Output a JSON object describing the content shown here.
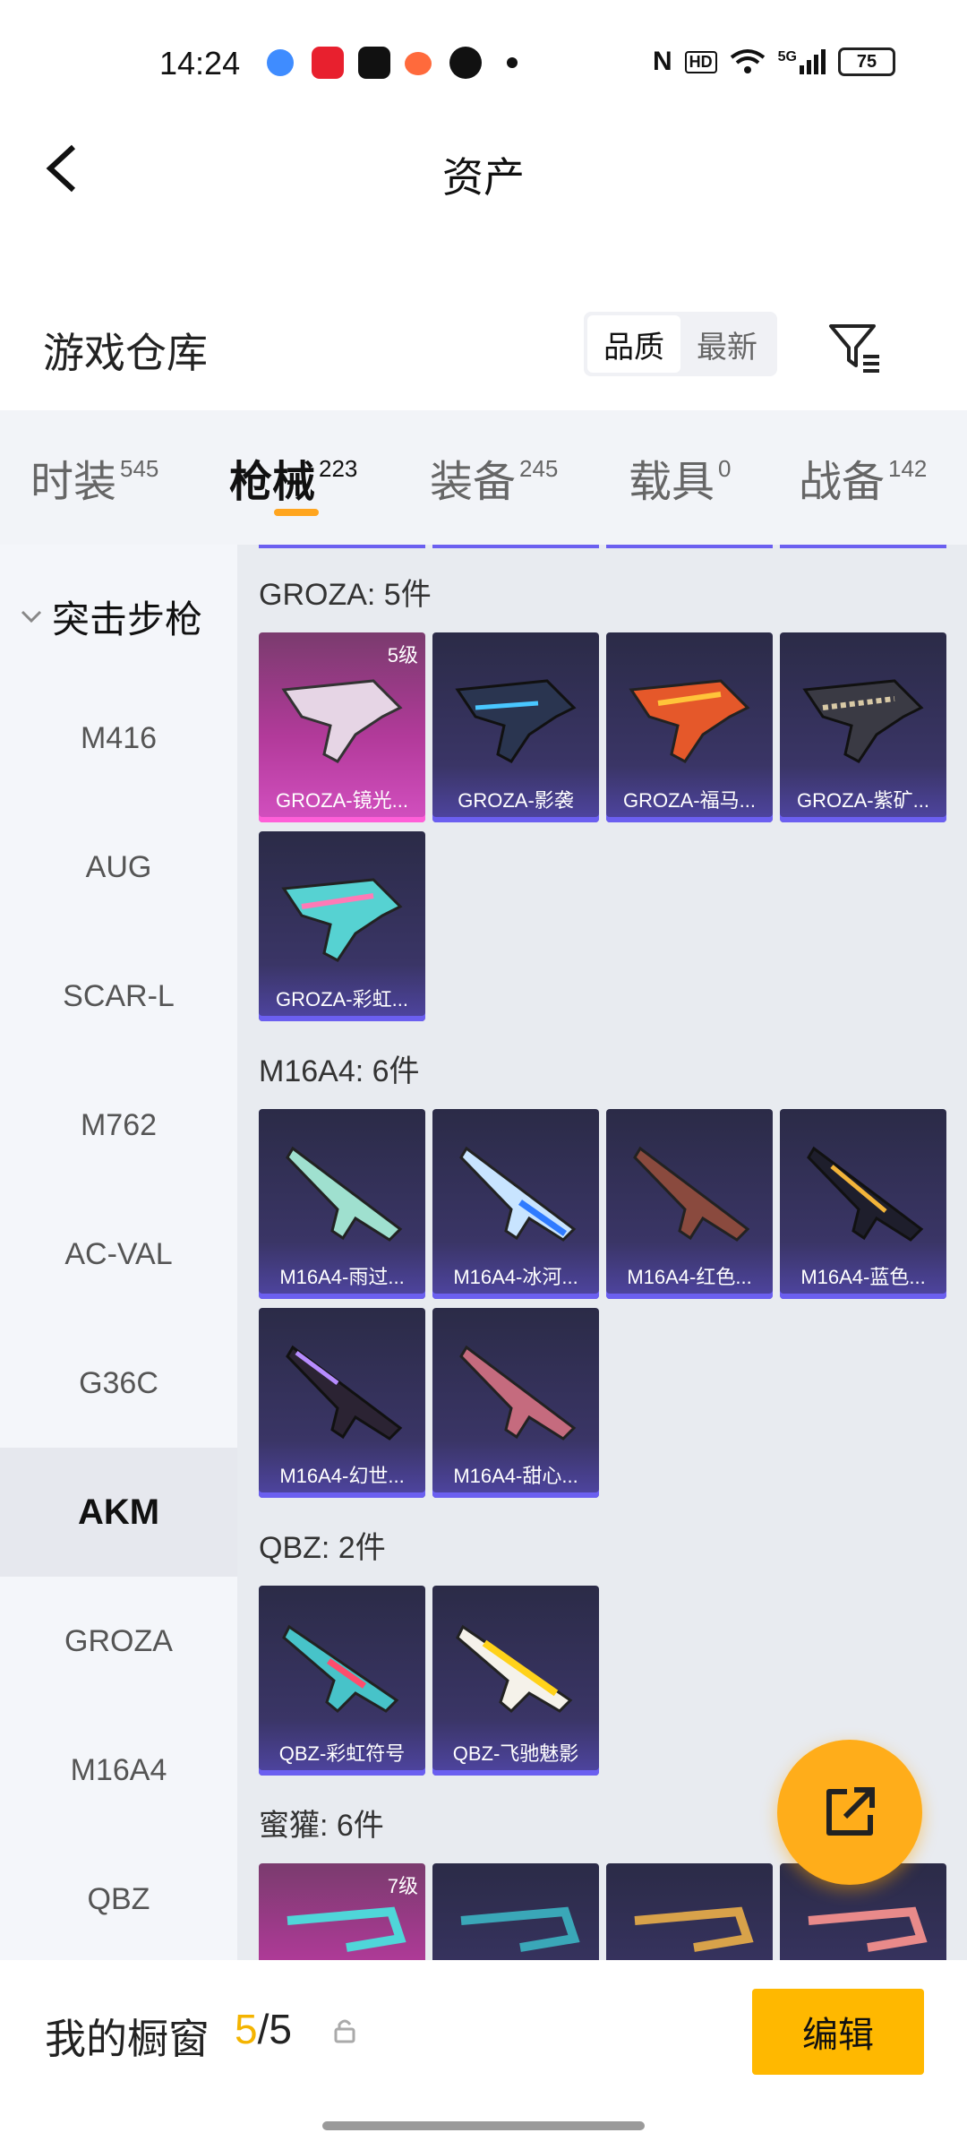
{
  "status_bar": {
    "time": "14:24",
    "network": "5G",
    "hd": "HD",
    "battery": "75"
  },
  "header": {
    "title": "资产",
    "back_icon": "back-arrow-icon"
  },
  "section": {
    "title": "游戏仓库",
    "sort_options": [
      "品质",
      "最新"
    ],
    "active_sort": "品质",
    "filter_icon": "filter-icon"
  },
  "tabs": [
    {
      "label": "时装",
      "count": "545"
    },
    {
      "label": "枪械",
      "count": "223",
      "active": true
    },
    {
      "label": "装备",
      "count": "245"
    },
    {
      "label": "载具",
      "count": "0"
    },
    {
      "label": "战备",
      "count": "142"
    }
  ],
  "sidebar": {
    "category": "突击步枪",
    "items": [
      "M416",
      "AUG",
      "SCAR-L",
      "M762",
      "AC-VAL",
      "G36C",
      "AKM",
      "GROZA",
      "M16A4",
      "QBZ"
    ],
    "active_item": "AKM"
  },
  "groups": [
    {
      "title": "GROZA: 5件",
      "items": [
        {
          "label": "GROZA-镜光...",
          "level": "5级",
          "rarity": "legend"
        },
        {
          "label": "GROZA-影袭",
          "rarity": "epic"
        },
        {
          "label": "GROZA-福马...",
          "rarity": "epic"
        },
        {
          "label": "GROZA-紫矿...",
          "rarity": "epic"
        },
        {
          "label": "GROZA-彩虹...",
          "rarity": "epic"
        }
      ]
    },
    {
      "title": "M16A4: 6件",
      "items": [
        {
          "label": "M16A4-雨过...",
          "rarity": "epic"
        },
        {
          "label": "M16A4-冰河...",
          "rarity": "epic"
        },
        {
          "label": "M16A4-红色...",
          "rarity": "epic"
        },
        {
          "label": "M16A4-蓝色...",
          "rarity": "epic"
        },
        {
          "label": "M16A4-幻世...",
          "rarity": "epic"
        },
        {
          "label": "M16A4-甜心...",
          "rarity": "epic"
        }
      ]
    },
    {
      "title": "QBZ: 2件",
      "items": [
        {
          "label": "QBZ-彩虹符号",
          "rarity": "epic"
        },
        {
          "label": "QBZ-飞驰魅影",
          "rarity": "epic"
        }
      ]
    },
    {
      "title": "蜜獾: 6件",
      "items": [
        {
          "label": "",
          "level": "7级",
          "rarity": "legend"
        },
        {
          "label": "",
          "rarity": "epic"
        },
        {
          "label": "",
          "rarity": "epic"
        },
        {
          "label": "",
          "rarity": "epic"
        }
      ]
    }
  ],
  "fab": {
    "icon": "share-external-icon"
  },
  "bottom_bar": {
    "label": "我的橱窗",
    "count_current": "5",
    "count_total": "/5",
    "lock_icon": "lock-icon",
    "edit_label": "编辑"
  },
  "colors": {
    "accent": "#ffb800",
    "tab_indicator": "#ffa51f",
    "epic": "#4f45a3",
    "legend": "#d350c0"
  }
}
